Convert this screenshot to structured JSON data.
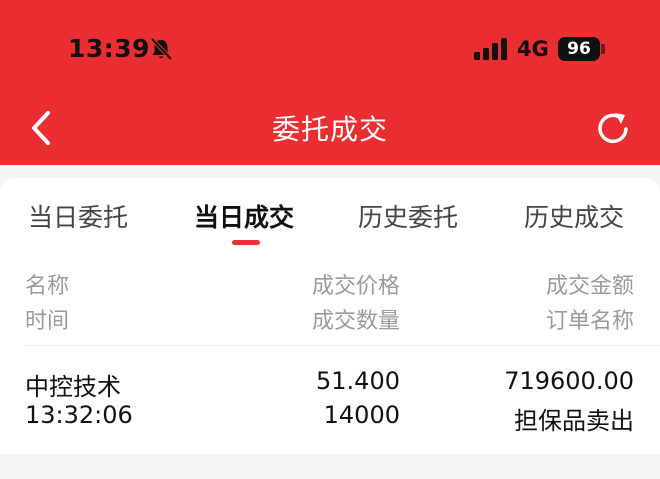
{
  "status_bar": {
    "time": "13:39",
    "network": "4G",
    "battery": "96"
  },
  "header": {
    "title": "委托成交"
  },
  "tabs": [
    {
      "label": "当日委托",
      "active": false
    },
    {
      "label": "当日成交",
      "active": true
    },
    {
      "label": "历史委托",
      "active": false
    },
    {
      "label": "历史成交",
      "active": false
    }
  ],
  "columns": {
    "name": "名称",
    "time": "时间",
    "price": "成交价格",
    "quantity": "成交数量",
    "amount": "成交金额",
    "order_type": "订单名称"
  },
  "rows": [
    {
      "name": "中控技术",
      "time": "13:32:06",
      "price": "51.400",
      "quantity": "14000",
      "amount": "719600.00",
      "order_type": "担保品卖出"
    }
  ],
  "colors": {
    "brand_red": "#ea2e32",
    "tab_indicator": "#e8323a",
    "header_text": "#9a9a9a"
  }
}
